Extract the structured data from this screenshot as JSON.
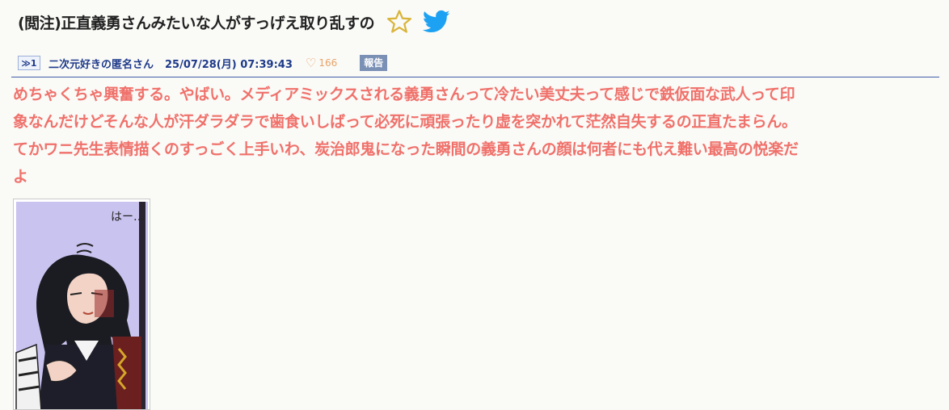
{
  "post": {
    "title": "(閲注)正直義勇さんみたいな人がすっげえ取り乱すの",
    "number": "≫1",
    "author": "二次元好きの匿名さん",
    "datetime": "25/07/28(月) 07:39:43",
    "likes": "166",
    "report_label": "報告",
    "body_lines": [
      "めちゃくちゃ興奮する。やばい。メディアミックスされる義勇さんって冷たい美丈夫って感じで鉄仮面な武人って印",
      "象なんだけどそんな人が汗ダラダラで歯食いしばって必死に頑張ったり虚を突かれて茫然自失するの正直たまらん。",
      "てかワニ先生表情描くのすっごく上手いわ、炭治郎鬼になった瞬間の義勇さんの顔は何者にも代え難い最高の悦楽だ",
      "よ"
    ],
    "image_text": "はー…"
  },
  "colors": {
    "body_text": "#f0716b",
    "link": "#1e3a8a",
    "divider": "#3f5fa8",
    "star": "#d9b43a",
    "twitter": "#1da1f2"
  },
  "icons": {
    "favorite": "star-icon",
    "share": "twitter-icon",
    "likes": "heart-icon"
  }
}
